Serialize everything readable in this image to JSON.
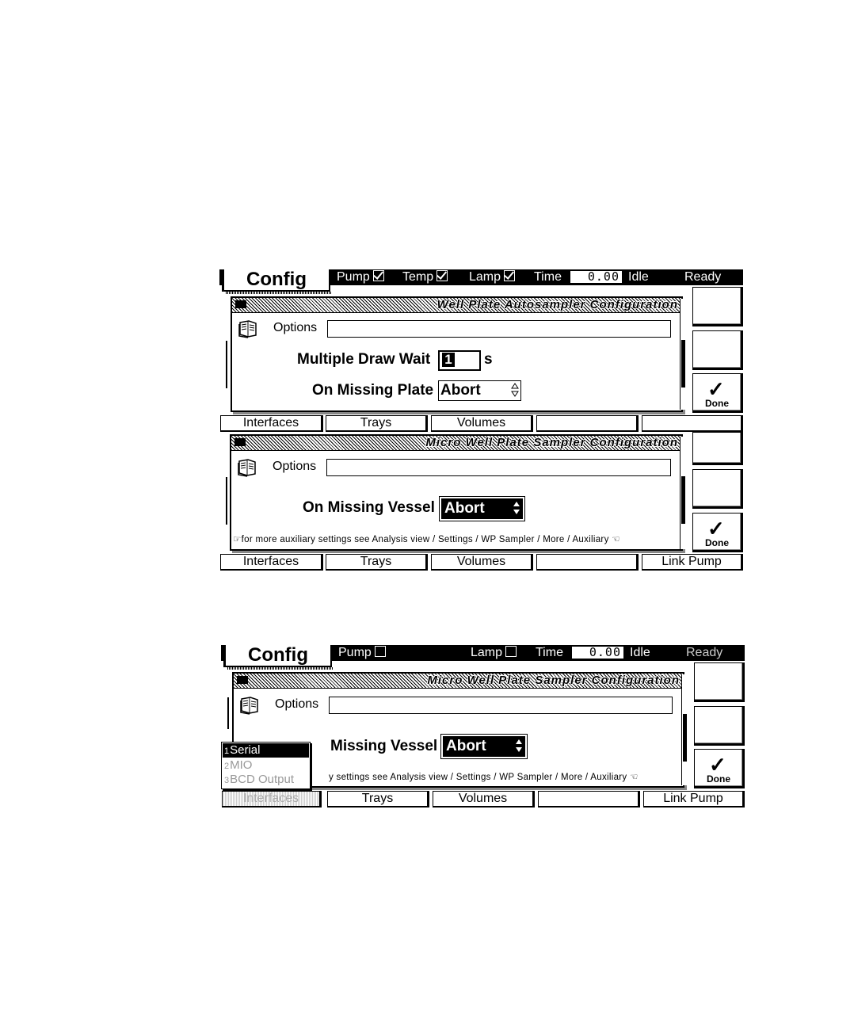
{
  "screen1": {
    "title": "Config",
    "status": {
      "pump_label": "Pump",
      "pump_checked": true,
      "temp_label": "Temp",
      "temp_checked": true,
      "lamp_label": "Lamp",
      "lamp_checked": true,
      "time_label": "Time",
      "time_value": "0.00",
      "run_state": "Idle",
      "ready_state": "Ready"
    },
    "dialog_a": {
      "title": "Well Plate Autosampler Configuration",
      "options_label": "Options",
      "options_value": "",
      "draw_wait_label": "Multiple Draw Wait",
      "draw_wait_value": "1",
      "draw_wait_unit": "s",
      "missing_plate_label": "On Missing Plate",
      "missing_plate_value": "Abort"
    },
    "softkeys_a": [
      "Interfaces",
      "Trays",
      "Volumes",
      "",
      ""
    ],
    "dialog_b": {
      "title": "Micro Well Plate Sampler Configuration",
      "options_label": "Options",
      "options_value": "",
      "missing_vessel_label": "On Missing Vessel",
      "missing_vessel_value": "Abort",
      "note": "for more auxiliary settings see Analysis view / Settings / WP Sampler / More / Auxiliary"
    },
    "softkeys_b": [
      "Interfaces",
      "Trays",
      "Volumes",
      "",
      "Link Pump"
    ],
    "done_label": "Done"
  },
  "screen2": {
    "title": "Config",
    "status": {
      "pump_label": "Pump",
      "pump_checked": false,
      "lamp_label": "Lamp",
      "lamp_checked": false,
      "time_label": "Time",
      "time_value": "0.00",
      "run_state": "Idle",
      "ready_state": "Ready"
    },
    "dialog": {
      "title": "Micro Well Plate Sampler Configuration",
      "options_label": "Options",
      "options_value": "",
      "missing_vessel_label": "Missing Vessel",
      "missing_vessel_value": "Abort",
      "note": "y settings see Analysis view / Settings / WP Sampler / More / Auxiliary"
    },
    "menu": [
      {
        "num": "1",
        "label": "Serial",
        "selected": true
      },
      {
        "num": "2",
        "label": "MIO",
        "selected": false
      },
      {
        "num": "3",
        "label": "BCD Output",
        "selected": false
      }
    ],
    "softkeys": [
      "Interfaces",
      "Trays",
      "Volumes",
      "",
      "Link Pump"
    ],
    "done_label": "Done"
  },
  "icons": {
    "checkbox_checked": "checkbox-checked-icon",
    "checkbox_empty": "checkbox-empty-icon",
    "options": "options-book-icon",
    "done": "checkmark-icon",
    "spinner": "up-down-spinner-icon",
    "hand_left": "pointing-hand-right-icon",
    "hand_right": "pointing-hand-left-icon"
  }
}
